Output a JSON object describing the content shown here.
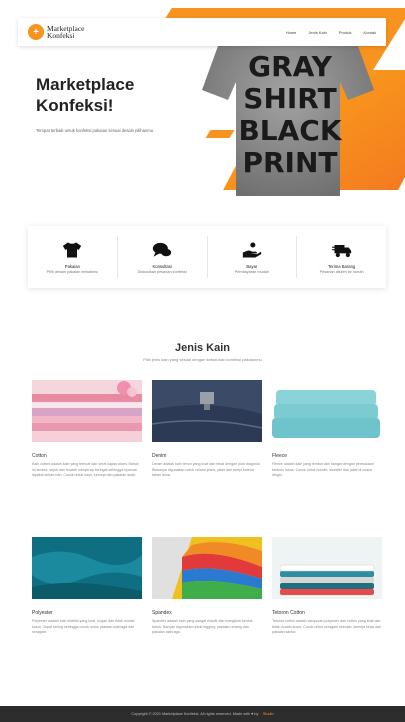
{
  "brand": {
    "name_line1": "Marketplace",
    "name_line2": "Konfeksi"
  },
  "nav": {
    "items": [
      "Home",
      "Jenis Kain",
      "Produk",
      "Kontak"
    ]
  },
  "hero": {
    "title": "Marketplace Konfeksi!",
    "subtitle": "Tempat terbaik untuk konfeksi pakaian sesuai desain pilihanmu",
    "tshirt_lines": [
      "GRAY",
      "SHIRT",
      "BLACK",
      "PRINT"
    ]
  },
  "features": [
    {
      "icon": "tshirt-icon",
      "title": "Pakaian",
      "desc": "Pilih desain pakaian terbaikmu"
    },
    {
      "icon": "chat-icon",
      "title": "Konsultasi",
      "desc": "Diskusikan pesanan konfeksi"
    },
    {
      "icon": "payment-icon",
      "title": "Bayar",
      "desc": "Pembayaran mudah"
    },
    {
      "icon": "delivery-truck-icon",
      "title": "Terima Barang",
      "desc": "Pesanan dikirim ke rumah"
    }
  ],
  "section": {
    "title": "Jenis Kain",
    "subtitle": "Pilih jenis kain yang sesuai dengan kebutuhan konfeksi pakaianmu"
  },
  "fabrics": [
    {
      "name": "Cotton",
      "desc": "Kain cotton adalah kain yang terbuat dari serat kapas alami. Bahan ini lembut, sejuk dan mudah menyerap keringat sehingga nyaman dipakai sehari-hari. Cocok untuk kaos, kemeja dan pakaian anak."
    },
    {
      "name": "Denim",
      "desc": "Denim adalah kain tenun yang kuat dan tebal dengan pola diagonal. Biasanya digunakan untuk celana jeans, jaket dan rompi karena tahan lama."
    },
    {
      "name": "Fleece",
      "desc": "Fleece adalah kain yang lembut dan hangat dengan permukaan berbulu halus. Cocok untuk hoodie, sweater dan jaket di cuaca dingin."
    },
    {
      "name": "Polyester",
      "desc": "Polyester adalah kain sintetis yang kuat, ringan dan tidak mudah kusut. Cepat kering sehingga cocok untuk pakaian olahraga dan seragam."
    },
    {
      "name": "Spandex",
      "desc": "Spandex adalah kain yang sangat elastis dan mengikuti bentuk tubuh. Banyak digunakan untuk legging, pakaian renang dan pakaian olahraga."
    },
    {
      "name": "Tetoron Cotton",
      "desc": "Tetoron cotton adalah campuran polyester dan cotton yang kuat dan tidak mudah kusut. Cocok untuk seragam sekolah, kemeja kerja dan pakaian kantor."
    }
  ],
  "footer": {
    "text": "Copyright © 2021 Marketplace Konfeksi. All rights reserved. Made with ♥ by",
    "brand": "Studio"
  }
}
